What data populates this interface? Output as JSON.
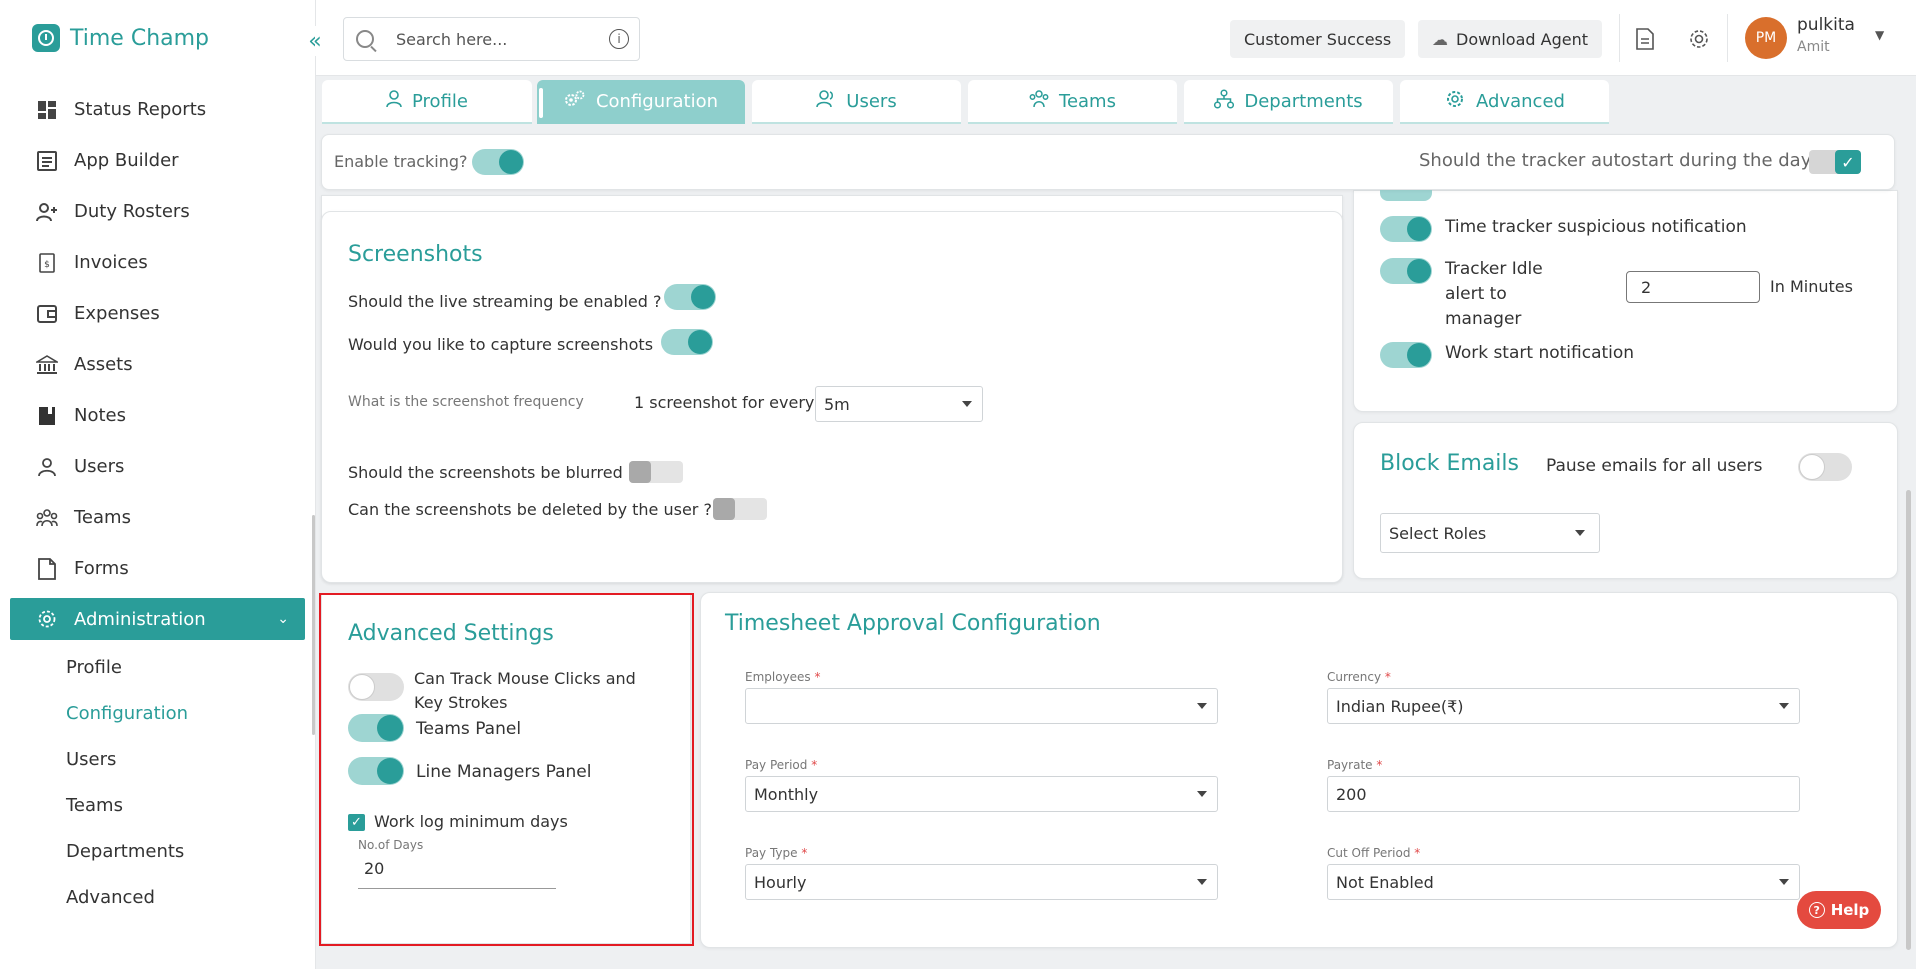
{
  "app": {
    "name": "Time Champ"
  },
  "sidebar": {
    "items": [
      {
        "label": "Status Reports",
        "icon": "dashboard-icon"
      },
      {
        "label": "App Builder",
        "icon": "app-builder-icon"
      },
      {
        "label": "Duty Rosters",
        "icon": "user-add-icon"
      },
      {
        "label": "Invoices",
        "icon": "invoice-icon"
      },
      {
        "label": "Expenses",
        "icon": "wallet-icon"
      },
      {
        "label": "Assets",
        "icon": "bank-icon"
      },
      {
        "label": "Notes",
        "icon": "notebook-icon"
      },
      {
        "label": "Users",
        "icon": "user-icon"
      },
      {
        "label": "Teams",
        "icon": "team-icon"
      },
      {
        "label": "Forms",
        "icon": "document-icon"
      }
    ],
    "admin": {
      "label": "Administration"
    },
    "subitems": [
      "Profile",
      "Configuration",
      "Users",
      "Teams",
      "Departments",
      "Advanced"
    ]
  },
  "topbar": {
    "search_placeholder": "Search here...",
    "customer_success": "Customer Success",
    "download_agent": "Download Agent",
    "avatar_initials": "PM",
    "user_name": "pulkita",
    "user_role": "Amit"
  },
  "tabs": [
    "Profile",
    "Configuration",
    "Users",
    "Teams",
    "Departments",
    "Advanced"
  ],
  "tracking": {
    "enable_label": "Enable tracking?",
    "autostart_label": "Should the tracker autostart during the day"
  },
  "screenshots": {
    "title": "Screenshots",
    "live_streaming": "Should the live streaming be enabled ?",
    "capture": "Would you like to capture screenshots",
    "frequency_label": "What is the screenshot frequency",
    "frequency_prefix": "1 screenshot for every",
    "frequency_value": "5m",
    "blurred": "Should the screenshots be blurred ?",
    "deleted": "Can the screenshots be deleted by the user ?"
  },
  "notifications": {
    "suspicious": "Time tracker suspicious notification",
    "idle_line1": "Tracker Idle",
    "idle_line2": "alert to",
    "idle_line3": "manager",
    "idle_value": "2",
    "idle_unit": "In Minutes",
    "work_start": "Work start notification"
  },
  "block_emails": {
    "title": "Block Emails",
    "pause_label": "Pause emails for all users",
    "roles_placeholder": "Select Roles"
  },
  "advanced": {
    "title": "Advanced Settings",
    "mouse_line1": "Can Track Mouse Clicks and",
    "mouse_line2": "Key Strokes",
    "teams_panel": "Teams Panel",
    "line_managers": "Line Managers Panel",
    "worklog_label": "Work log minimum days",
    "days_label": "No.of Days",
    "days_value": "20"
  },
  "timesheet": {
    "title": "Timesheet Approval Configuration",
    "employees_label": "Employees",
    "employees_value": "",
    "currency_label": "Currency",
    "currency_value": "Indian Rupee(₹)",
    "pay_period_label": "Pay Period",
    "pay_period_value": "Monthly",
    "payrate_label": "Payrate",
    "payrate_value": "200",
    "pay_type_label": "Pay Type",
    "pay_type_value": "Hourly",
    "cutoff_label": "Cut Off Period",
    "cutoff_value": "Not Enabled",
    "required_mark": "*"
  },
  "help": {
    "label": "Help"
  },
  "colors": {
    "accent": "#2a9d99",
    "highlight": "#e31b23",
    "help": "#e44a3f"
  }
}
